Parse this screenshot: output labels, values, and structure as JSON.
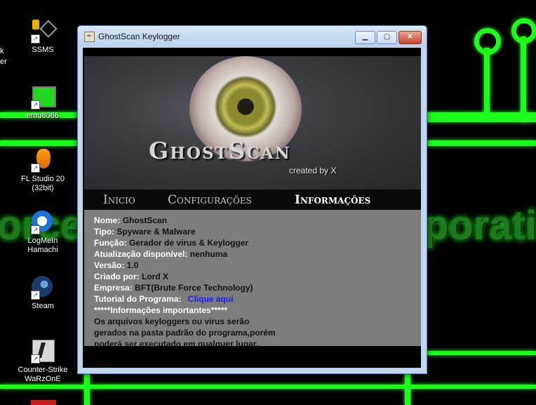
{
  "desktop": {
    "icons": [
      {
        "label_line1": "SSMS",
        "label_line2": ""
      },
      {
        "label_line1": "emu8086",
        "label_line2": ""
      },
      {
        "label_line1": "FL Studio 20",
        "label_line2": "(32bit)"
      },
      {
        "label_line1": "LogMeIn",
        "label_line2": "Hamachi"
      },
      {
        "label_line1": "Steam",
        "label_line2": ""
      },
      {
        "label_line1": "Counter-Strike",
        "label_line2": "WaRzOnE"
      }
    ],
    "partial_left_1": "k",
    "partial_left_2": "er",
    "wallpaper_text_left": "orce",
    "wallpaper_text_right": "porati",
    "accent_color": "#1aff1a"
  },
  "window": {
    "title": "GhostScan Keylogger",
    "minimize_glyph": "▁",
    "maximize_glyph": "▢",
    "close_glyph": "✕"
  },
  "banner": {
    "brand": "GhostScan",
    "created_by": "created by X"
  },
  "menu": {
    "tabs": [
      "Inicio",
      "Configurações",
      "Informações"
    ],
    "active": "Informações"
  },
  "info": {
    "nome_k": "Nome:",
    "nome_v": "GhostScan",
    "tipo_k": "Tipo:",
    "tipo_v": "Spyware & Malware",
    "funcao_k": "Função:",
    "funcao_v": "Gerador de virus & Keylogger",
    "atual_k": "Atualização disponível:",
    "atual_v": "nenhuma",
    "versao_k": "Versão:",
    "versao_v": "1.0",
    "criado_k": "Criado por:",
    "criado_v": "Lord X",
    "empresa_k": "Empresa:",
    "empresa_v": "BFT(Brute Force Technology)",
    "tutorial_k": "Tutorial do Programa:",
    "tutorial_link": "Clique aqui",
    "importantes": "*****Informações importantes*****",
    "texto_1": "Os arquivos keyloggers ou virus serão",
    "texto_2": "gerados na pasta padrão do programa,porém",
    "texto_3": "poderá ser executado em qualquer lugar."
  }
}
